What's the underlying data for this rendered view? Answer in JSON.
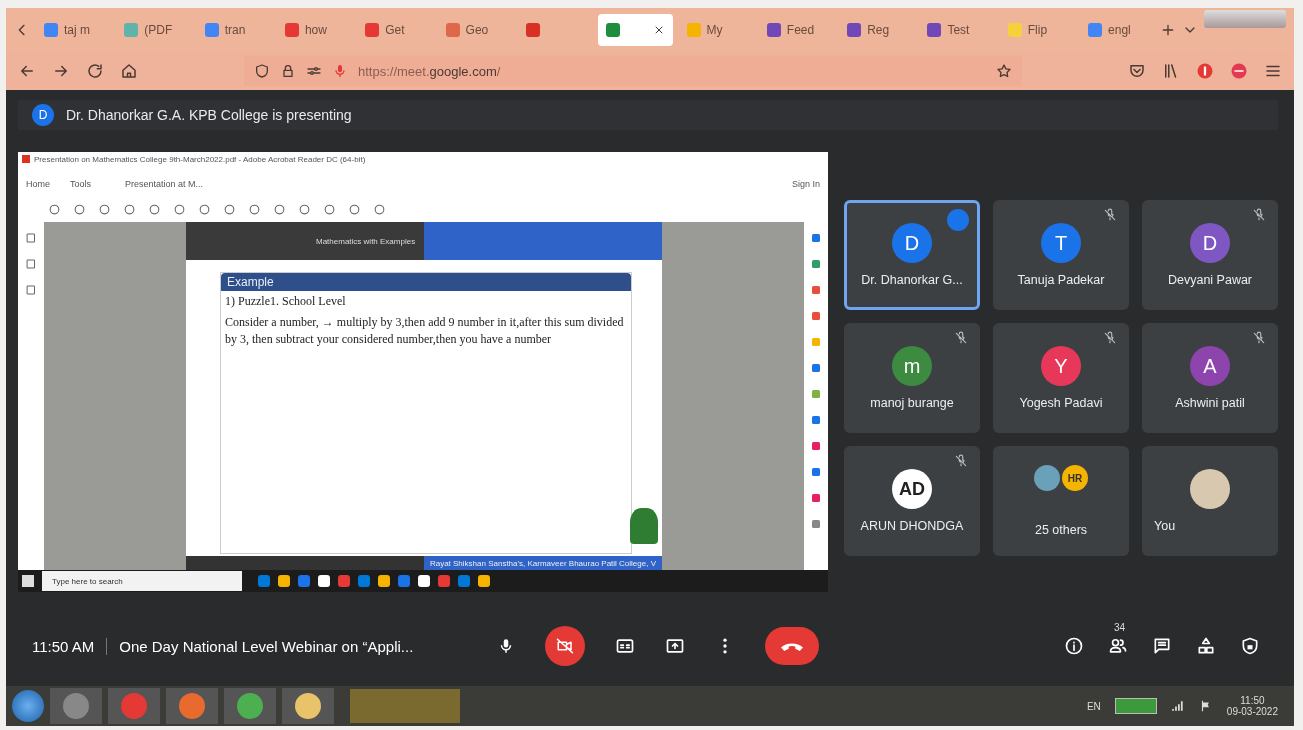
{
  "browser": {
    "tabs": [
      {
        "label": "taj m",
        "selected": false,
        "color": "#4285f4"
      },
      {
        "label": "(PDF",
        "selected": false,
        "color": "#5fb3a8"
      },
      {
        "label": "tran",
        "selected": false,
        "color": "#4285f4"
      },
      {
        "label": "how",
        "selected": false,
        "color": "#e53935"
      },
      {
        "label": "Get",
        "selected": false,
        "color": "#e53935"
      },
      {
        "label": "Geo",
        "selected": false,
        "color": "#e0684a"
      },
      {
        "selected": false,
        "color": "#d93025"
      },
      {
        "selected": true,
        "color": "#1e8e3e"
      },
      {
        "label": "My",
        "selected": false,
        "color": "#f4b400"
      },
      {
        "label": "Feed",
        "selected": false,
        "color": "#7248b9"
      },
      {
        "label": "Reg",
        "selected": false,
        "color": "#7248b9"
      },
      {
        "label": "Test",
        "selected": false,
        "color": "#7248b9"
      },
      {
        "label": "Flip",
        "selected": false,
        "color": "#f7d13b"
      },
      {
        "label": "engl",
        "selected": false,
        "color": "#4285f4"
      }
    ],
    "url_domain": "google.com",
    "url_prefix": "https://meet.",
    "url_rest": "/"
  },
  "presenting": {
    "initial": "D",
    "text": "Dr. Dhanorkar G.A. KPB College is presenting"
  },
  "shared_screen": {
    "window_title": "Presentation on Mathematics College 9th-March2022.pdf - Adobe Acrobat Reader DC (64-bit)",
    "nav": [
      "Home",
      "Tools"
    ],
    "doc_tab": "Presentation at M...",
    "sign_in": "Sign In",
    "slide_header": "Mathematics with Examples",
    "block_title": "Example",
    "lines": [
      "1) Puzzle1. School Level",
      "Consider a number, → multiply by 3,then add 9 number in it,after this sum divided by 3, then subtract your considered number,then you have a number"
    ],
    "footer": "Rayat Shikshan Sanstha's, Karmaveer Bhaurao Patil College, V",
    "search_placeholder": "Type here to search"
  },
  "tiles": [
    {
      "kind": "initial",
      "initial": "D",
      "name": "Dr. Dhanorkar G...",
      "color": "#1a73e8",
      "muted": false,
      "speaking": true
    },
    {
      "kind": "initial",
      "initial": "T",
      "name": "Tanuja Padekar",
      "color": "#1a73e8",
      "muted": true,
      "speaking": false
    },
    {
      "kind": "initial",
      "initial": "D",
      "name": "Devyani Pawar",
      "color": "#7e57c2",
      "muted": true,
      "speaking": false
    },
    {
      "kind": "initial",
      "initial": "m",
      "name": "manoj burange",
      "color": "#3d8b40",
      "muted": true,
      "speaking": false
    },
    {
      "kind": "initial",
      "initial": "Y",
      "name": "Yogesh Padavi",
      "color": "#e8385a",
      "muted": true,
      "speaking": false
    },
    {
      "kind": "initial",
      "initial": "A",
      "name": "Ashwini patil",
      "color": "#8e44ad",
      "muted": true,
      "speaking": false
    },
    {
      "kind": "photo",
      "initial": "AD",
      "name": "ARUN DHONDGA",
      "color": "#ffffff",
      "muted": true,
      "speaking": false
    },
    {
      "kind": "group",
      "initial": "HR",
      "name": "25 others",
      "color": "#f4b400",
      "muted": false,
      "speaking": false
    },
    {
      "kind": "photo",
      "name": "You",
      "color": "#d8c8b0",
      "muted": false,
      "speaking": false
    }
  ],
  "meeting_bar": {
    "time": "11:50 AM",
    "title": "One Day National Level Webinar on “Appli...",
    "people_count": "34",
    "camera_on": false
  },
  "taskbar": {
    "lang": "EN",
    "clock": "11:50",
    "date": "09-03-2022"
  }
}
